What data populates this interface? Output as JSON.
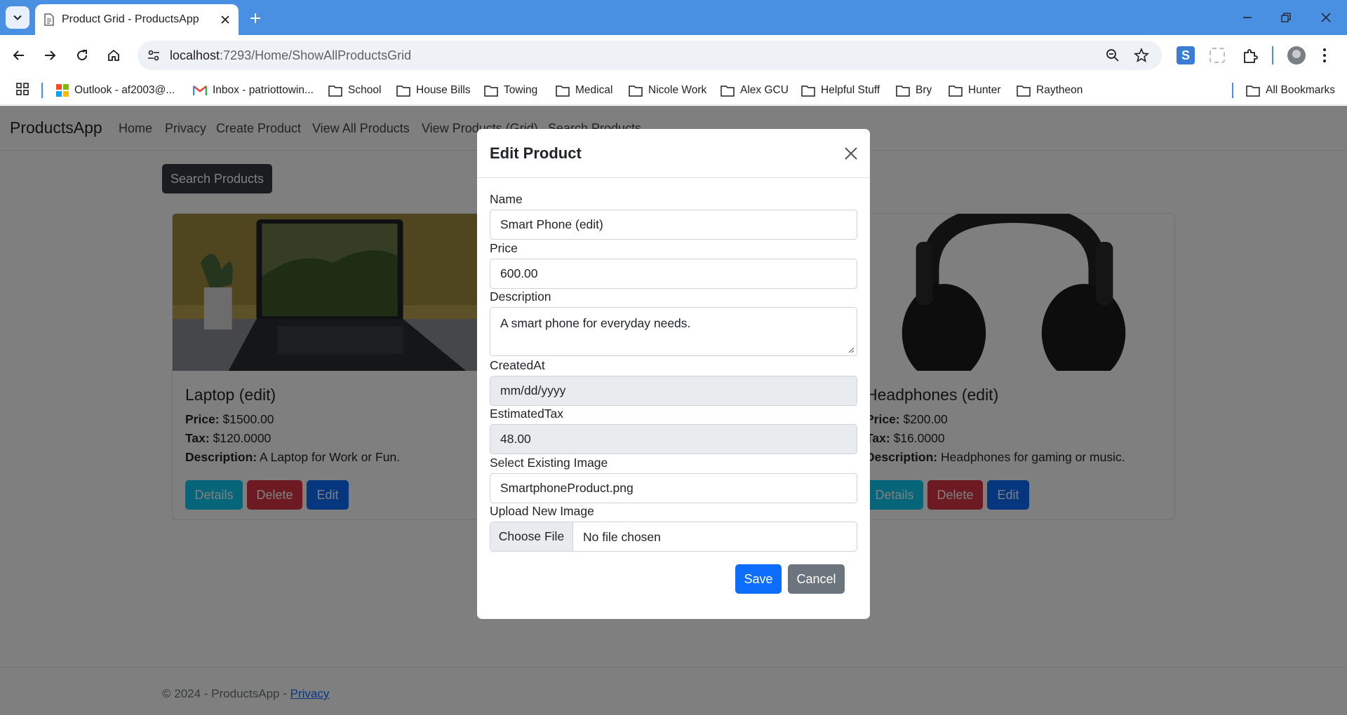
{
  "browser": {
    "tab_title": "Product Grid - ProductsApp",
    "url_host": "localhost",
    "url_rest": ":7293/Home/ShowAllProductsGrid",
    "bookmarks": [
      {
        "label": "Outlook - af2003@...",
        "icon": "microsoft-logo-icon"
      },
      {
        "label": "Inbox - patriottowin...",
        "icon": "gmail-icon"
      },
      {
        "label": "School",
        "icon": "folder-icon"
      },
      {
        "label": "House Bills",
        "icon": "folder-icon"
      },
      {
        "label": "Towing",
        "icon": "folder-icon"
      },
      {
        "label": "Medical",
        "icon": "folder-icon"
      },
      {
        "label": "Nicole Work",
        "icon": "folder-icon"
      },
      {
        "label": "Alex GCU",
        "icon": "folder-icon"
      },
      {
        "label": "Helpful Stuff",
        "icon": "folder-icon"
      },
      {
        "label": "Bry",
        "icon": "folder-icon"
      },
      {
        "label": "Hunter",
        "icon": "folder-icon"
      },
      {
        "label": "Raytheon",
        "icon": "folder-icon"
      }
    ],
    "all_bookmarks": "All Bookmarks"
  },
  "app": {
    "brand": "ProductsApp",
    "nav": [
      "Home",
      "Privacy",
      "Create Product",
      "View All Products",
      "View Products (Grid)",
      "Search Products"
    ],
    "search_button": "Search Products",
    "cards": [
      {
        "title": "Laptop (edit)",
        "price_label": "Price:",
        "price": "$1500.00",
        "tax_label": "Tax:",
        "tax": "$120.0000",
        "desc_label": "Description:",
        "desc": "A Laptop for Work or Fun."
      },
      {
        "title": "Headphones (edit)",
        "price_label": "Price:",
        "price": "$200.00",
        "tax_label": "Tax:",
        "tax": "$16.0000",
        "desc_label": "Description:",
        "desc": "Headphones for gaming or music."
      }
    ],
    "card_buttons": {
      "details": "Details",
      "delete": "Delete",
      "edit": "Edit"
    },
    "footer_text": "© 2024 - ProductsApp - ",
    "footer_link": "Privacy"
  },
  "modal": {
    "title": "Edit Product",
    "name_label": "Name",
    "name_value": "Smart Phone (edit)",
    "price_label": "Price",
    "price_value": "600.00",
    "desc_label": "Description",
    "desc_value": "A smart phone for everyday needs.",
    "created_label": "CreatedAt",
    "created_value": "mm/dd/yyyy",
    "tax_label": "EstimatedTax",
    "tax_value": "48.00",
    "image_label": "Select Existing Image",
    "image_value": "SmartphoneProduct.png",
    "upload_label": "Upload New Image",
    "upload_button": "Choose File",
    "upload_status": "No file chosen",
    "save": "Save",
    "cancel": "Cancel"
  },
  "colors": {
    "chrome_blue": "#4a90e2",
    "primary": "#0d6efd",
    "danger": "#dc3545",
    "info": "#0dcaf0",
    "secondary": "#6c757d",
    "dark": "#343a40"
  }
}
